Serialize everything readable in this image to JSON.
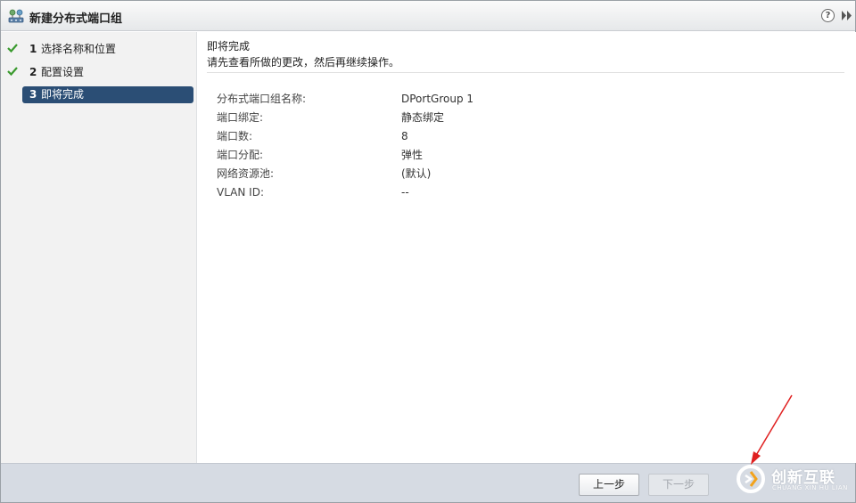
{
  "window": {
    "title": "新建分布式端口组"
  },
  "sidebar": {
    "steps": [
      {
        "num": "1",
        "label": "选择名称和位置",
        "done": true
      },
      {
        "num": "2",
        "label": "配置设置",
        "done": true
      },
      {
        "num": "3",
        "label": "即将完成",
        "active": true
      }
    ]
  },
  "content": {
    "heading": "即将完成",
    "subheading": "请先查看所做的更改，然后再继续操作。",
    "summary": [
      {
        "key": "分布式端口组名称:",
        "value": "DPortGroup 1"
      },
      {
        "key": "端口绑定:",
        "value": "静态绑定"
      },
      {
        "key": "端口数:",
        "value": "8"
      },
      {
        "key": "端口分配:",
        "value": "弹性"
      },
      {
        "key": "网络资源池:",
        "value": "(默认)"
      },
      {
        "key": "VLAN ID:",
        "value": "--"
      }
    ]
  },
  "footer": {
    "back_label": "上一步",
    "next_label": "下一步"
  },
  "watermark": {
    "name": "创新互联",
    "sub": "CHUANG XIN HU LIAN"
  },
  "colors": {
    "active_step": "#2b4e75",
    "check": "#3a9a2e",
    "arrow": "#e02020"
  },
  "icons": {
    "title": "distributed-switch-icon",
    "help": "help-icon",
    "expand": "double-chevron-right-icon"
  }
}
